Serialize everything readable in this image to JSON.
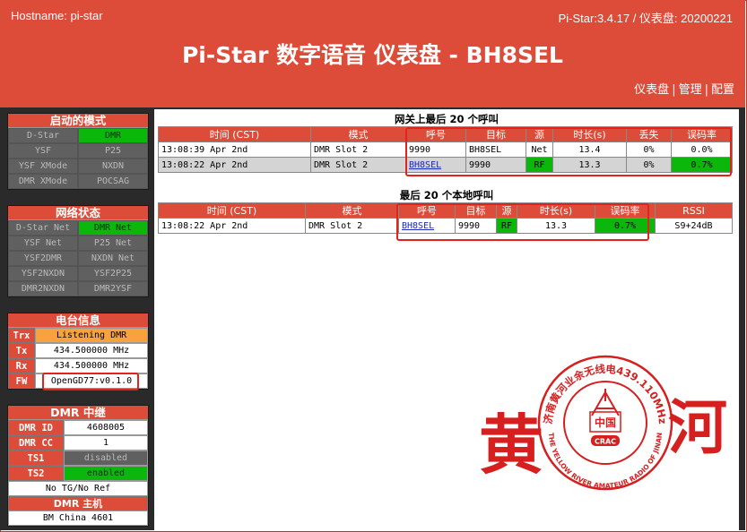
{
  "header": {
    "hostname": "Hostname: pi-star",
    "version": "Pi-Star:3.4.17 / 仪表盘: 20200221",
    "title": "Pi-Star 数字语音 仪表盘 - BH8SEL",
    "nav": [
      "仪表盘",
      "管理",
      "配置"
    ]
  },
  "modes": {
    "title": "启动的模式",
    "items": [
      {
        "label": "D-Star",
        "on": false
      },
      {
        "label": "DMR",
        "on": true
      },
      {
        "label": "YSF",
        "on": false
      },
      {
        "label": "P25",
        "on": false
      },
      {
        "label": "YSF XMode",
        "on": false
      },
      {
        "label": "NXDN",
        "on": false
      },
      {
        "label": "DMR XMode",
        "on": false
      },
      {
        "label": "POCSAG",
        "on": false
      }
    ]
  },
  "network": {
    "title": "网络状态",
    "items": [
      {
        "label": "D-Star Net",
        "on": false
      },
      {
        "label": "DMR Net",
        "on": true
      },
      {
        "label": "YSF Net",
        "on": false
      },
      {
        "label": "P25 Net",
        "on": false
      },
      {
        "label": "YSF2DMR",
        "on": false
      },
      {
        "label": "NXDN Net",
        "on": false
      },
      {
        "label": "YSF2NXDN",
        "on": false
      },
      {
        "label": "YSF2P25",
        "on": false
      },
      {
        "label": "DMR2NXDN",
        "on": false
      },
      {
        "label": "DMR2YSF",
        "on": false
      }
    ]
  },
  "radio": {
    "title": "电台信息",
    "trx_label": "Trx",
    "trx": "Listening DMR",
    "tx_label": "Tx",
    "tx": "434.500000 MHz",
    "rx_label": "Rx",
    "rx": "434.500000 MHz",
    "fw_label": "FW",
    "fw": "OpenGD77:v0.1.0"
  },
  "dmr": {
    "title": "DMR 中继",
    "id_label": "DMR ID",
    "id": "4608005",
    "cc_label": "DMR CC",
    "cc": "1",
    "ts1_label": "TS1",
    "ts1": "disabled",
    "ts2_label": "TS2",
    "ts2": "enabled",
    "tg": "No TG/No Ref",
    "master_title": "DMR 主机",
    "master": "BM China 4601"
  },
  "gateway": {
    "title": "网关上最后 20 个呼叫",
    "headers": [
      "时间 (CST)",
      "模式",
      "呼号",
      "目标",
      "源",
      "时长(s)",
      "丢失",
      "误码率"
    ],
    "rows": [
      {
        "time": "13:08:39 Apr 2nd",
        "mode": "DMR Slot 2",
        "callsign": "9990",
        "target": "BH8SEL",
        "src": "Net",
        "dur": "13.4",
        "loss": "0%",
        "ber": "0.0%"
      },
      {
        "time": "13:08:22 Apr 2nd",
        "mode": "DMR Slot 2",
        "callsign": "BH8SEL",
        "target": "9990",
        "src": "RF",
        "dur": "13.3",
        "loss": "0%",
        "ber": "0.7%"
      }
    ]
  },
  "local": {
    "title": "最后 20 个本地呼叫",
    "headers": [
      "时间 (CST)",
      "模式",
      "呼号",
      "目标",
      "源",
      "时长(s)",
      "误码率",
      "RSSI"
    ],
    "rows": [
      {
        "time": "13:08:22 Apr 2nd",
        "mode": "DMR Slot 2",
        "callsign": "BH8SEL",
        "target": "9990",
        "src": "RF",
        "dur": "13.3",
        "ber": "0.7%",
        "rssi": "S9+24dB"
      }
    ]
  },
  "logo": {
    "char_left": "黄",
    "char_right": "河",
    "seal_top": "济南黄河业余无线电439.110MHz",
    "seal_bottom": "THE YELLOW RIVER AMATEUR RADIO OF JINAN",
    "seal_center": "中国",
    "seal_badge": "CRAC",
    "color": "#d61f1f"
  }
}
